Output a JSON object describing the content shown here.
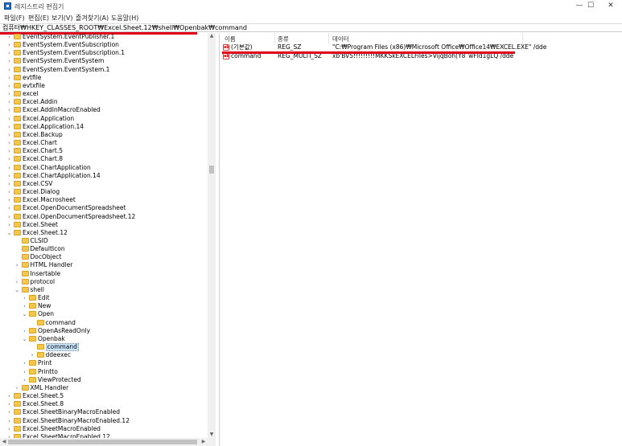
{
  "window": {
    "title": "레지스트리 편집기",
    "minimize_glyph": "—",
    "maximize_glyph": "☐",
    "close_glyph": "✕"
  },
  "menu": [
    "파일(F)",
    "편집(E)",
    "보기(V)",
    "즐겨찾기(A)",
    "도움말(H)"
  ],
  "address": "컴퓨터₩HKEY_CLASSES_ROOT₩Excel.Sheet.12₩shell₩Openbak₩command",
  "accent_color": "#e1001a",
  "folder_color": "#f4c74c",
  "selected_color": "#cce8ff",
  "tree": [
    {
      "label": "EventSystem.EventPublisher.1",
      "depth": 0,
      "exp": "›"
    },
    {
      "label": "EventSystem.EventSubscription",
      "depth": 0,
      "exp": "›"
    },
    {
      "label": "EventSystem.EventSubscription.1",
      "depth": 0,
      "exp": "›"
    },
    {
      "label": "EventSystem.EventSystem",
      "depth": 0,
      "exp": "›"
    },
    {
      "label": "EventSystem.EventSystem.1",
      "depth": 0,
      "exp": "›"
    },
    {
      "label": "evtfile",
      "depth": 0,
      "exp": "›"
    },
    {
      "label": "evtxfile",
      "depth": 0,
      "exp": "›"
    },
    {
      "label": "excel",
      "depth": 0,
      "exp": "›"
    },
    {
      "label": "Excel.Addin",
      "depth": 0,
      "exp": "›"
    },
    {
      "label": "Excel.AddInMacroEnabled",
      "depth": 0,
      "exp": "›"
    },
    {
      "label": "Excel.Application",
      "depth": 0,
      "exp": "›"
    },
    {
      "label": "Excel.Application.14",
      "depth": 0,
      "exp": "›"
    },
    {
      "label": "Excel.Backup",
      "depth": 0,
      "exp": "›"
    },
    {
      "label": "Excel.Chart",
      "depth": 0,
      "exp": "›"
    },
    {
      "label": "Excel.Chart.5",
      "depth": 0,
      "exp": "›"
    },
    {
      "label": "Excel.Chart.8",
      "depth": 0,
      "exp": "›"
    },
    {
      "label": "Excel.ChartApplication",
      "depth": 0,
      "exp": "›"
    },
    {
      "label": "Excel.ChartApplication.14",
      "depth": 0,
      "exp": "›"
    },
    {
      "label": "Excel.CSV",
      "depth": 0,
      "exp": "›"
    },
    {
      "label": "Excel.Dialog",
      "depth": 0,
      "exp": "›"
    },
    {
      "label": "Excel.Macrosheet",
      "depth": 0,
      "exp": "›"
    },
    {
      "label": "Excel.OpenDocumentSpreadsheet",
      "depth": 0,
      "exp": "›"
    },
    {
      "label": "Excel.OpenDocumentSpreadsheet.12",
      "depth": 0,
      "exp": "›"
    },
    {
      "label": "Excel.Sheet",
      "depth": 0,
      "exp": "›"
    },
    {
      "label": "Excel.Sheet.12",
      "depth": 0,
      "exp": "⌄"
    },
    {
      "label": "CLSID",
      "depth": 1,
      "exp": ""
    },
    {
      "label": "DefaultIcon",
      "depth": 1,
      "exp": ""
    },
    {
      "label": "DocObject",
      "depth": 1,
      "exp": ""
    },
    {
      "label": "HTML Handler",
      "depth": 1,
      "exp": "›"
    },
    {
      "label": "Insertable",
      "depth": 1,
      "exp": ""
    },
    {
      "label": "protocol",
      "depth": 1,
      "exp": "›"
    },
    {
      "label": "shell",
      "depth": 1,
      "exp": "⌄"
    },
    {
      "label": "Edit",
      "depth": 2,
      "exp": "›"
    },
    {
      "label": "New",
      "depth": 2,
      "exp": "›"
    },
    {
      "label": "Open",
      "depth": 2,
      "exp": "⌄"
    },
    {
      "label": "command",
      "depth": 3,
      "exp": ""
    },
    {
      "label": "OpenAsReadOnly",
      "depth": 2,
      "exp": "›"
    },
    {
      "label": "Openbak",
      "depth": 2,
      "exp": "⌄"
    },
    {
      "label": "command",
      "depth": 3,
      "exp": "",
      "selected": true
    },
    {
      "label": "ddeexec",
      "depth": 3,
      "exp": "›"
    },
    {
      "label": "Print",
      "depth": 2,
      "exp": "›"
    },
    {
      "label": "Printto",
      "depth": 2,
      "exp": "›"
    },
    {
      "label": "ViewProtected",
      "depth": 2,
      "exp": "›"
    },
    {
      "label": "XML Handler",
      "depth": 1,
      "exp": "›"
    },
    {
      "label": "Excel.Sheet.5",
      "depth": 0,
      "exp": "›"
    },
    {
      "label": "Excel.Sheet.8",
      "depth": 0,
      "exp": "›"
    },
    {
      "label": "Excel.SheetBinaryMacroEnabled",
      "depth": 0,
      "exp": "›"
    },
    {
      "label": "Excel.SheetBinaryMacroEnabled.12",
      "depth": 0,
      "exp": "›"
    },
    {
      "label": "Excel.SheetMacroEnabled",
      "depth": 0,
      "exp": "›"
    },
    {
      "label": "Excel.SheetMacroEnabled.12",
      "depth": 0,
      "exp": "›"
    }
  ],
  "columns": {
    "name": "이름",
    "type": "종류",
    "data": "데이터"
  },
  "values": [
    {
      "name": "(기본값)",
      "type": "REG_SZ",
      "data": "\"C:₩Program Files (x86)₩Microsoft Office₩Office14₩EXCEL.EXE\" /dde",
      "icon": "ab"
    },
    {
      "name": "command",
      "type": "REG_MULTI_SZ",
      "data": "xb'BV5!!!!!!!!!MKKSkEXCELFiles>VijqBoh(Y8`wFId1gLQ /dde",
      "icon": "ab"
    }
  ],
  "scroll": {
    "up": "▲",
    "down": "▼",
    "left": "◀",
    "right": "▶"
  }
}
